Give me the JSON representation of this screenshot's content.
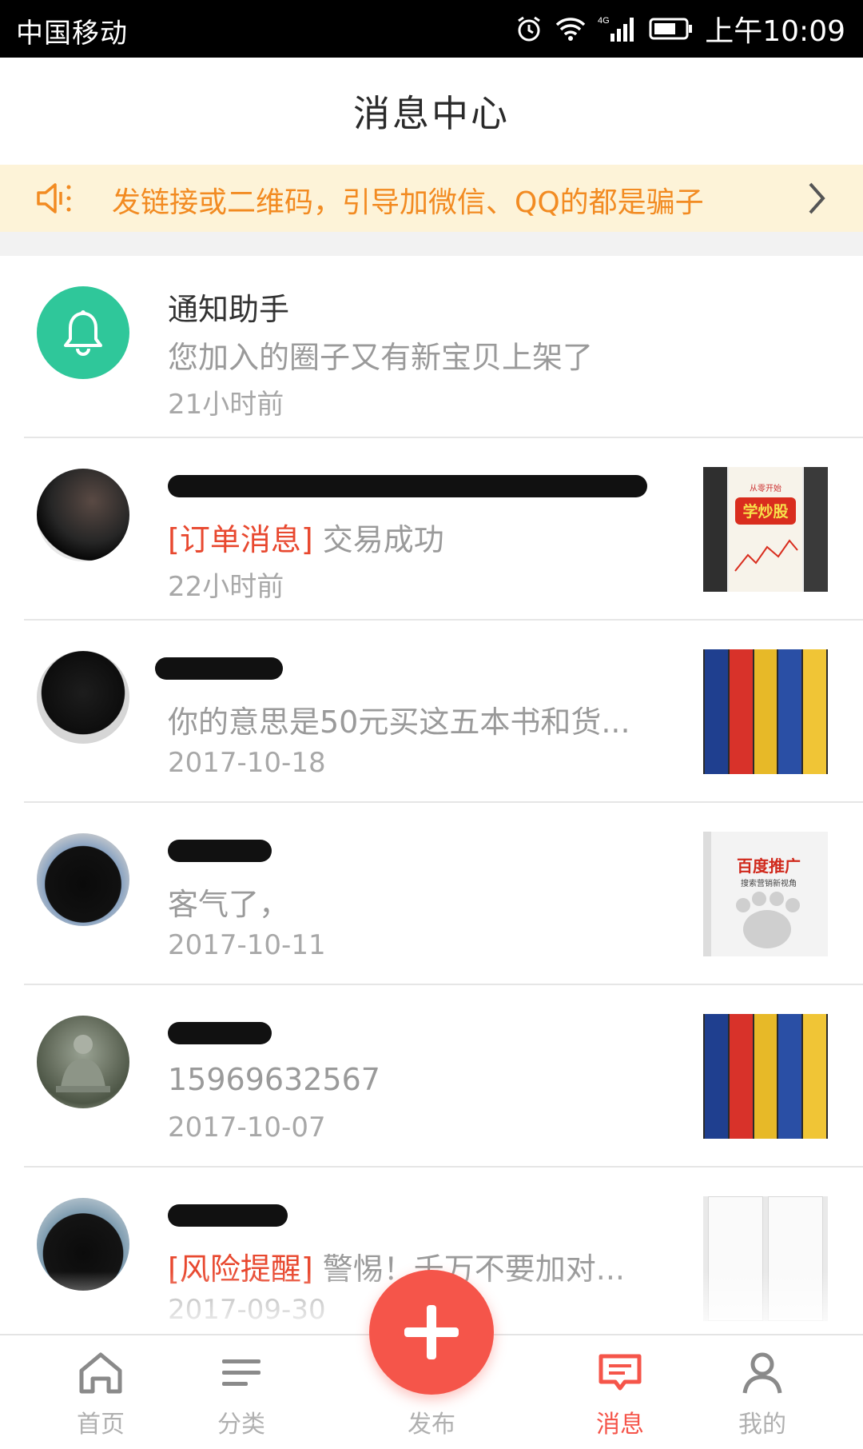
{
  "status_bar": {
    "carrier": "中国移动",
    "network": "4G",
    "time": "上午10:09"
  },
  "header": {
    "title": "消息中心"
  },
  "notice": {
    "text": "发链接或二维码，引导加微信、QQ的都是骗子"
  },
  "messages": [
    {
      "sender": "通知助手",
      "tag": "",
      "text": "您加入的圈子又有新宝贝上架了",
      "time": "21小时前",
      "avatar": "bell-icon"
    },
    {
      "sender": "",
      "tag": "[订单消息]",
      "text": " 交易成功",
      "time": "22小时前",
      "avatar": "user-photo"
    },
    {
      "sender": "",
      "tag": "",
      "text": "你的意思是50元买这五本书和货...",
      "time": "2017-10-18",
      "avatar": "user-photo"
    },
    {
      "sender": "",
      "tag": "",
      "text": "客气了，",
      "time": "2017-10-11",
      "avatar": "user-photo"
    },
    {
      "sender": "",
      "tag": "",
      "text": "15969632567",
      "time": "2017-10-07",
      "avatar": "buddha-photo"
    },
    {
      "sender": "",
      "tag": "[风险提醒]",
      "text": " 警惕！千万不要加对...",
      "time": "2017-09-30",
      "avatar": "user-photo"
    }
  ],
  "thumbnails": {
    "book1_title": "从零开始学炒股",
    "book3_title": "百度推广",
    "book3_subtitle": "搜索营销新视角"
  },
  "fab": {
    "label": "发布"
  },
  "nav": {
    "items": [
      {
        "label": "首页",
        "icon": "home-icon"
      },
      {
        "label": "分类",
        "icon": "category-icon"
      },
      {
        "label": "发布",
        "icon": "add-icon"
      },
      {
        "label": "消息",
        "icon": "message-icon"
      },
      {
        "label": "我的",
        "icon": "profile-icon"
      }
    ],
    "active_index": 3
  },
  "colors": {
    "accent": "#f5554a",
    "notice_bg": "#fdf3d8",
    "notice_text": "#f28b22",
    "bell_bg": "#2fc79a",
    "tag": "#e8482f"
  }
}
